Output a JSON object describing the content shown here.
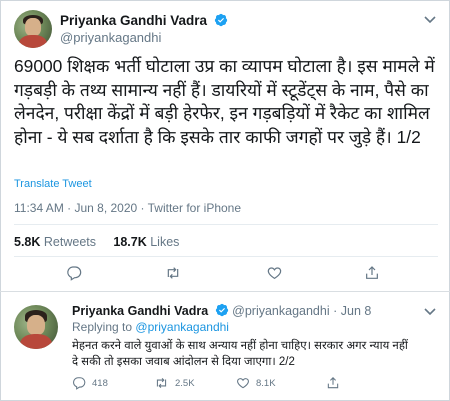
{
  "main_tweet": {
    "author_name": "Priyanka Gandhi Vadra",
    "handle": "@priyankagandhi",
    "text": "69000 शिक्षक भर्ती घोटाला उप्र का व्यापम घोटाला है। इस मामले में गड़बड़ी के तथ्य सामान्य नहीं हैं। डायरियों में स्टूडेंट्स के नाम, पैसे का लेनदेन, परीक्षा केंद्रों में बड़ी हेरफेर, इन गड़बड़ियों में रैकेट का शामिल होना - ये सब दर्शाता है कि इसके तार काफी जगहों पर जुड़े हैं। 1/2",
    "translate_label": "Translate Tweet",
    "timestamp": "11:34 AM · Jun 8, 2020 · Twitter for iPhone",
    "retweets_count": "5.8K",
    "retweets_label": "Retweets",
    "likes_count": "18.7K",
    "likes_label": "Likes"
  },
  "reply_tweet": {
    "author_name": "Priyanka Gandhi Vadra",
    "handle": "@priyankagandhi",
    "separator": "·",
    "date": "Jun 8",
    "replying_prefix": "Replying to",
    "replying_to": "@priyankagandhi",
    "text": "मेहनत करने वाले युवाओं के साथ अन्याय नहीं होना चाहिए। सरकार अगर न्याय नहीं दे सकी तो इसका जवाब आंदोलन से दिया जाएगा। 2/2",
    "reply_count": "418",
    "retweet_count": "2.5K",
    "like_count": "8.1K"
  },
  "icons": {
    "verified": "verified-badge-icon",
    "reply": "reply-icon",
    "retweet": "retweet-icon",
    "like": "heart-icon",
    "share": "share-icon",
    "more": "chevron-down-icon"
  },
  "colors": {
    "accent": "#1b95e0",
    "text": "#14171a",
    "secondary": "#657786"
  }
}
